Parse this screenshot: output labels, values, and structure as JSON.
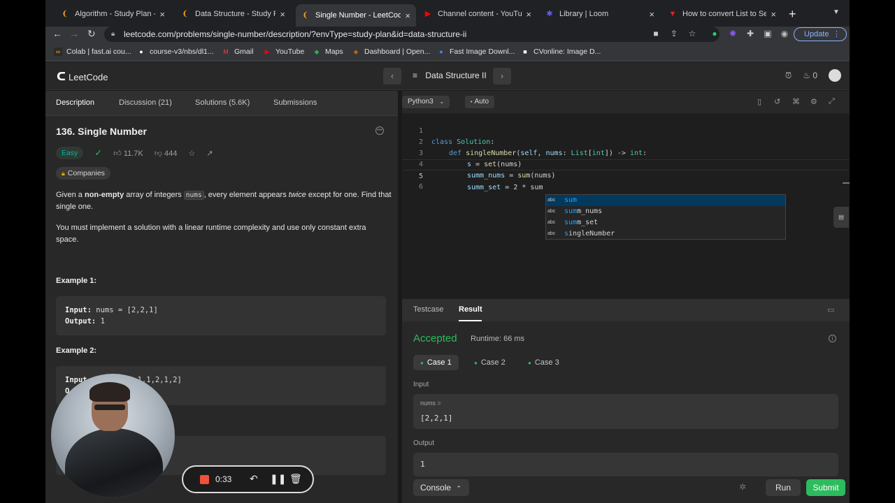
{
  "browser": {
    "tabs": [
      {
        "title": "Algorithm - Study Plan - Le",
        "favicon": "leetcode-icon",
        "fav_glyph": "❨",
        "fav_color": "#ffa116"
      },
      {
        "title": "Data Structure - Study Plan",
        "favicon": "leetcode-icon",
        "fav_glyph": "❨",
        "fav_color": "#ffa116"
      },
      {
        "title": "Single Number - LeetCode",
        "favicon": "leetcode-icon",
        "fav_glyph": "❨",
        "fav_color": "#ffa116"
      },
      {
        "title": "Channel content - YouTube",
        "favicon": "youtube-icon",
        "fav_glyph": "▶",
        "fav_color": "#ff0000"
      },
      {
        "title": "Library | Loom",
        "favicon": "loom-icon",
        "fav_glyph": "✱",
        "fav_color": "#625df5"
      },
      {
        "title": "How to convert List to Set",
        "favicon": "site-icon",
        "fav_glyph": "▼",
        "fav_color": "#e02424"
      }
    ],
    "url": "leetcode.com/problems/single-number/description/?envType=study-plan&id=data-structure-ii",
    "update_label": "Update",
    "bookmarks": [
      {
        "label": "Colab | fast.ai cou...",
        "color": "#f9ab00",
        "glyph": "∞"
      },
      {
        "label": "course-v3/nbs/dl1...",
        "color": "#ffffff",
        "glyph": "●"
      },
      {
        "label": "Gmail",
        "color": "#ea4335",
        "glyph": "M"
      },
      {
        "label": "YouTube",
        "color": "#ff0000",
        "glyph": "▶"
      },
      {
        "label": "Maps",
        "color": "#34a853",
        "glyph": "◆"
      },
      {
        "label": "Dashboard | Open...",
        "color": "#e37400",
        "glyph": "◈"
      },
      {
        "label": "Fast Image Downl...",
        "color": "#4285f4",
        "glyph": "●"
      },
      {
        "label": "CVonline: Image D...",
        "color": "#ffffff",
        "glyph": "■"
      }
    ]
  },
  "lc": {
    "brand": "LeetCode",
    "plan_title": "Data Structure II",
    "streak": "0"
  },
  "problem": {
    "tabs": [
      "Description",
      "Discussion (21)",
      "Solutions (5.6K)",
      "Submissions"
    ],
    "title": "136. Single Number",
    "difficulty": "Easy",
    "likes": "11.7K",
    "dislikes": "444",
    "companies": "Companies",
    "p1_a": "Given a ",
    "p1_b": "non-empty",
    "p1_c": " array of integers ",
    "p1_code": "nums",
    "p1_d": ", every element appears ",
    "p1_e": "twice",
    "p1_f": " except for one. Find that single one.",
    "p2": "You must implement a solution with a linear runtime complexity and use only constant extra space.",
    "ex1_title": "Example 1:",
    "ex1_input_label": "Input:",
    "ex1_input": " nums = [2,2,1]",
    "ex1_output_label": "Output:",
    "ex1_output": " 1",
    "ex2_title": "Example 2:",
    "ex2_visible_a": "Input",
    "ex2_visible_b": "1,1,2,1,2]",
    "ex2_visible_c": "O"
  },
  "editor": {
    "language": "Python3",
    "mode": "Auto",
    "lines": [
      "1",
      "2",
      "3",
      "4",
      "5",
      "6"
    ],
    "code": {
      "l1_kw": "class",
      "l1_cls": " Solution",
      "l1_rest": ":",
      "l2_kw": "def",
      "l2_fn": " singleNumber",
      "l2_a": "(",
      "l2_self": "self",
      "l2_b": ", ",
      "l2_nums": "nums",
      "l2_c": ": ",
      "l2_list": "List",
      "l2_d": "[",
      "l2_int": "int",
      "l2_e": "]) -> ",
      "l2_int2": "int",
      "l2_f": ":",
      "l3_s": "s",
      "l3_a": " = ",
      "l3_fn": "set",
      "l3_b": "(nums)",
      "l4_v": "summ_nums",
      "l4_a": " = ",
      "l4_fn": "sum",
      "l4_b": "(nums)",
      "l5_v": "summ_set",
      "l5_a": " = 2 * sum"
    },
    "autocomplete": [
      {
        "tag": "abc",
        "match": "sum",
        "rest": ""
      },
      {
        "tag": "abc",
        "match": "sum",
        "rest": "m_nums"
      },
      {
        "tag": "abc",
        "match": "sum",
        "rest": "m_set"
      },
      {
        "tag": "abc",
        "match": "s",
        "rest": "ingleNumber"
      }
    ]
  },
  "result": {
    "tabs": [
      "Testcase",
      "Result"
    ],
    "status": "Accepted",
    "runtime": "Runtime: 66 ms",
    "cases": [
      "Case 1",
      "Case 2",
      "Case 3"
    ],
    "input_label": "Input",
    "var_name": "nums =",
    "var_value": "[2,2,1]",
    "output_label": "Output",
    "output_value": "1",
    "console_label": "Console",
    "run_label": "Run",
    "submit_label": "Submit"
  },
  "recorder": {
    "time": "0:33"
  }
}
